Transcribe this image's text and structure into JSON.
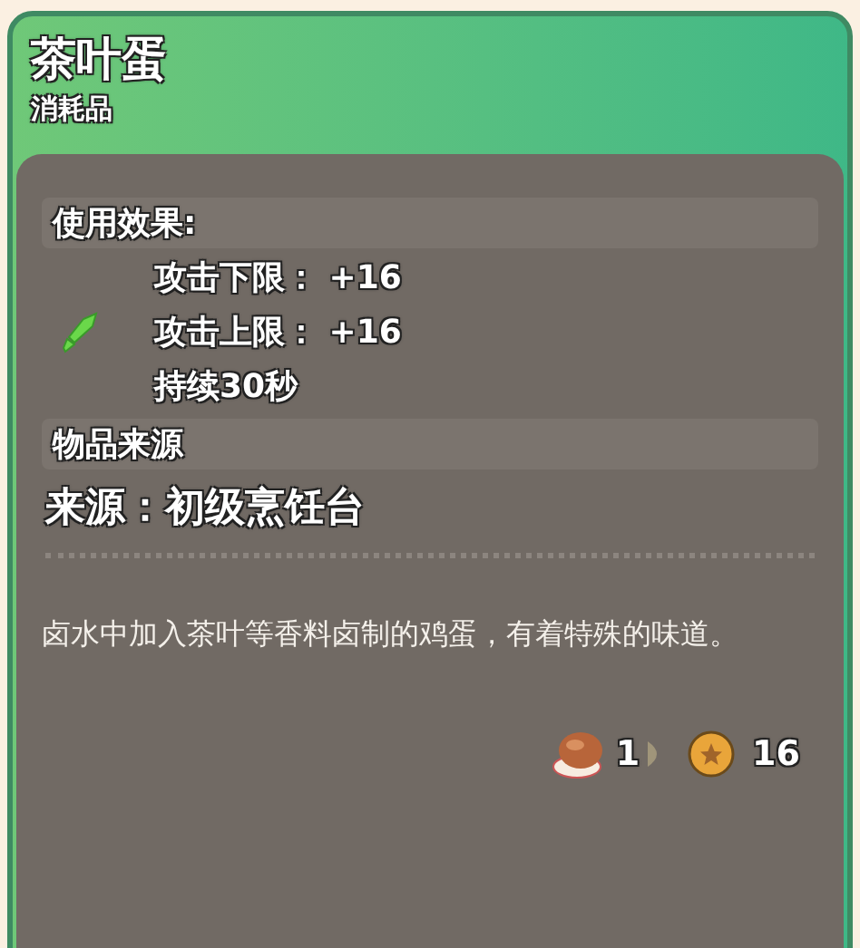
{
  "item": {
    "name": "茶叶蛋",
    "category": "消耗品"
  },
  "effect": {
    "heading": "使用效果:",
    "lines": [
      "攻击下限： +16",
      "攻击上限： +16",
      "持续30秒"
    ]
  },
  "source": {
    "heading": "物品来源",
    "text": "来源：初级烹饪台"
  },
  "description": "卤水中加入茶叶等香料卤制的鸡蛋，有着特殊的味道。",
  "exchange": {
    "input_count": "1",
    "output_count": "16"
  }
}
